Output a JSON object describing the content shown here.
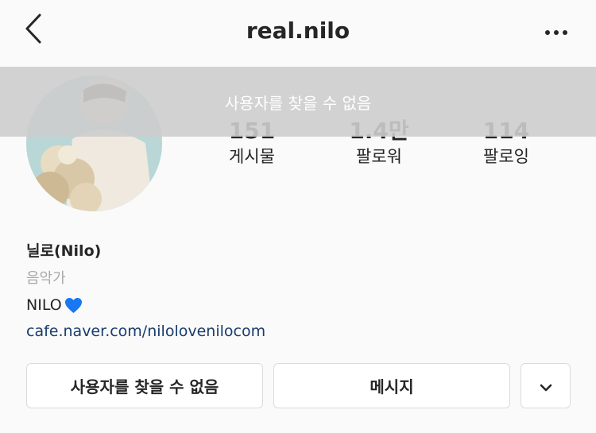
{
  "header": {
    "title": "real.nilo",
    "back_icon": "chevron-left-icon",
    "more_icon": "more-horizontal-icon"
  },
  "toast": {
    "message": "사용자를 찾을 수 없음"
  },
  "stats": [
    {
      "value": "151",
      "label": "게시물"
    },
    {
      "value": "1.4만",
      "label": "팔로워"
    },
    {
      "value": "114",
      "label": "팔로잉"
    }
  ],
  "bio": {
    "name": "닐로(Nilo)",
    "category": "음악가",
    "text": "NILO",
    "heart_color": "#1877f2",
    "link": "cafe.naver.com/nilolovenilocom"
  },
  "actions": {
    "follow_label": "사용자를 찾을 수 없음",
    "message_label": "메시지",
    "dropdown_icon": "chevron-down-icon"
  },
  "colors": {
    "background": "#fafafa",
    "text": "#262626",
    "link": "#1a3c6e",
    "secondary": "#a8a8a8",
    "toast_bg": "#cdcdcd"
  }
}
